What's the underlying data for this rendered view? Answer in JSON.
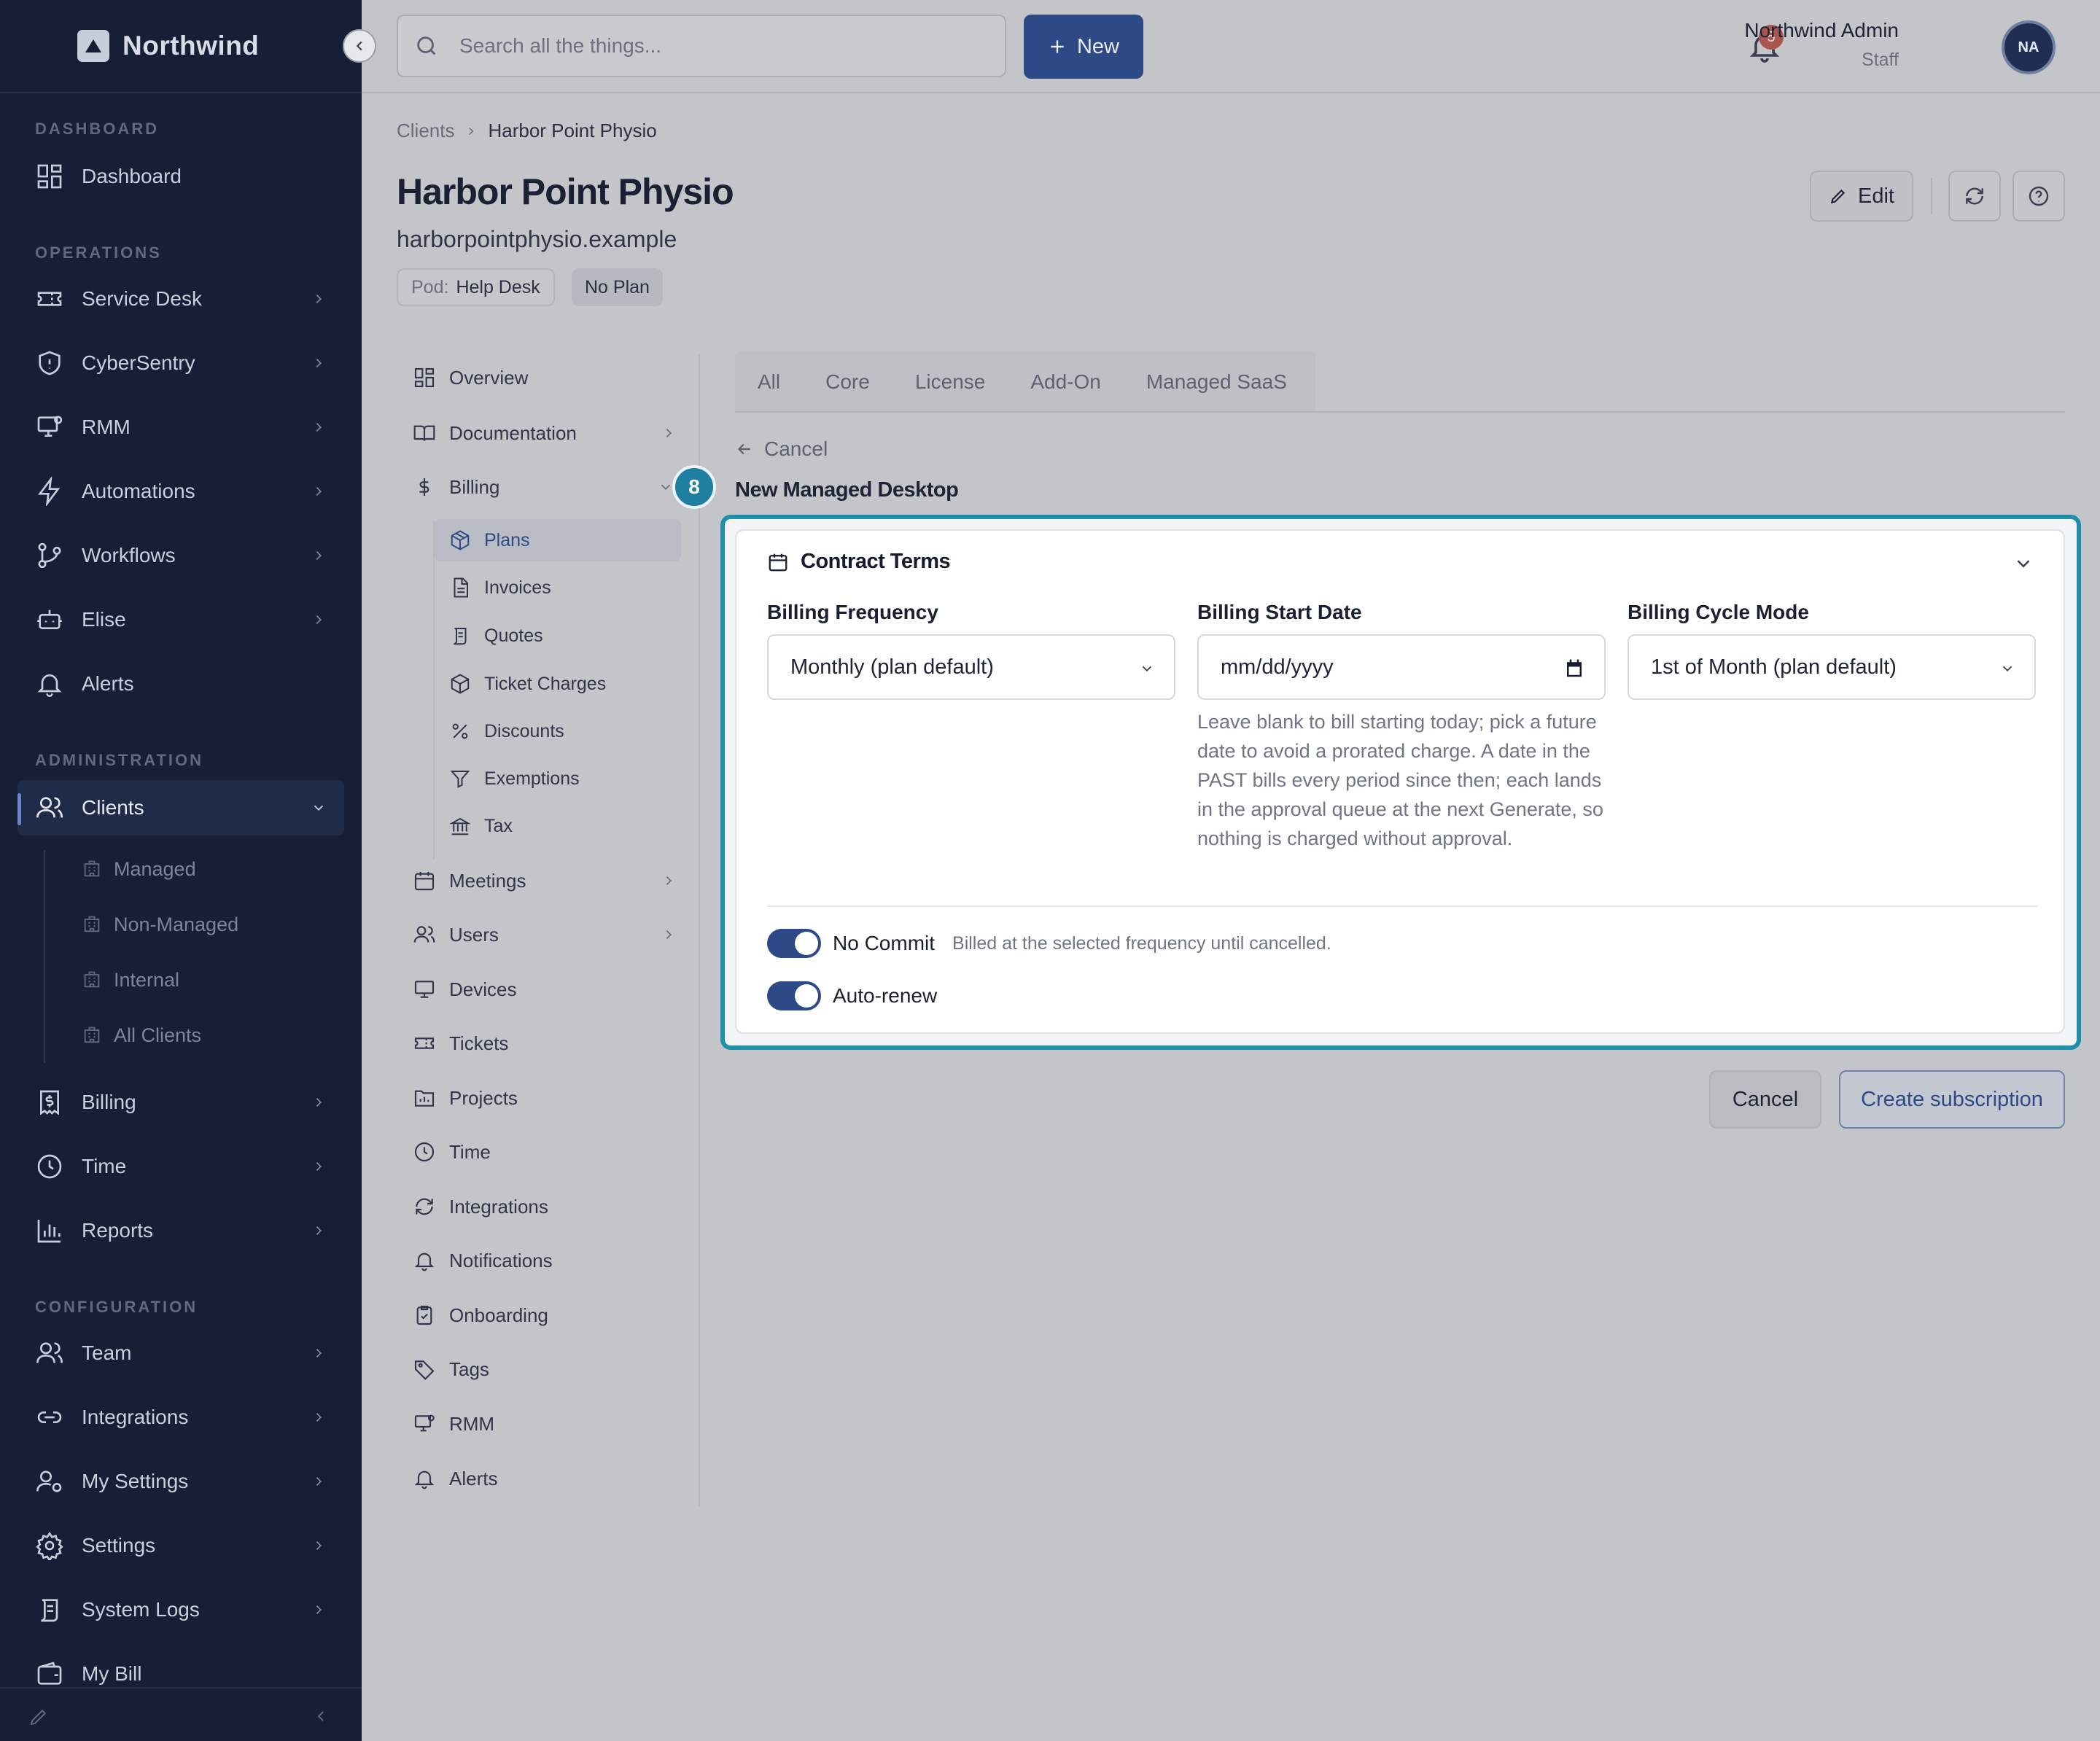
{
  "sidebar": {
    "brand": "Northwind",
    "sections": {
      "dashboard": "DASHBOARD",
      "operations": "OPERATIONS",
      "administration": "ADMINISTRATION",
      "configuration": "CONFIGURATION"
    },
    "items": {
      "dashboard": "Dashboard",
      "service_desk": "Service Desk",
      "cybersentry": "CyberSentry",
      "rmm": "RMM",
      "automations": "Automations",
      "workflows": "Workflows",
      "elise": "Elise",
      "alerts": "Alerts",
      "clients": "Clients",
      "billing": "Billing",
      "time": "Time",
      "reports": "Reports",
      "team": "Team",
      "integrations": "Integrations",
      "my_settings": "My Settings",
      "settings": "Settings",
      "system_logs": "System Logs",
      "my_bill": "My Bill"
    },
    "client_sub": {
      "managed": "Managed",
      "non_managed": "Non-Managed",
      "internal": "Internal",
      "all_clients": "All Clients"
    }
  },
  "topbar": {
    "search_placeholder": "Search all the things...",
    "new_label": "New",
    "notification_count": "5",
    "user_name": "Northwind Admin",
    "user_role": "Staff",
    "avatar_initials": "NA"
  },
  "breadcrumb": {
    "parent": "Clients",
    "current": "Harbor Point Physio"
  },
  "client": {
    "name": "Harbor Point Physio",
    "domain": "harborpointphysio.example",
    "pod_label": "Pod:",
    "pod_value": "Help Desk",
    "plan_badge": "No Plan",
    "edit_label": "Edit"
  },
  "client_nav": {
    "overview": "Overview",
    "documentation": "Documentation",
    "billing": "Billing",
    "billing_sub": {
      "plans": "Plans",
      "invoices": "Invoices",
      "quotes": "Quotes",
      "ticket_charges": "Ticket Charges",
      "discounts": "Discounts",
      "exemptions": "Exemptions",
      "tax": "Tax"
    },
    "meetings": "Meetings",
    "users": "Users",
    "devices": "Devices",
    "tickets": "Tickets",
    "projects": "Projects",
    "time": "Time",
    "integrations": "Integrations",
    "notifications": "Notifications",
    "onboarding": "Onboarding",
    "tags": "Tags",
    "rmm": "RMM",
    "alerts": "Alerts"
  },
  "tabs": [
    "All",
    "Core",
    "License",
    "Add-On",
    "Managed SaaS"
  ],
  "form": {
    "back_label": "Cancel",
    "title": "New Managed Desktop",
    "step_number": "8",
    "section_title": "Contract Terms",
    "billing_frequency_label": "Billing Frequency",
    "billing_frequency_value": "Monthly (plan default)",
    "billing_start_label": "Billing Start Date",
    "billing_start_placeholder": "mm/dd/yyyy",
    "billing_start_help": "Leave blank to bill starting today; pick a future date to avoid a prorated charge. A date in the PAST bills every period since then; each lands in the approval queue at the next Generate, so nothing is charged without approval.",
    "billing_cycle_label": "Billing Cycle Mode",
    "billing_cycle_value": "1st of Month (plan default)",
    "no_commit_label": "No Commit",
    "no_commit_desc": "Billed at the selected frequency until cancelled.",
    "auto_renew_label": "Auto-renew",
    "cancel_label": "Cancel",
    "create_label": "Create subscription"
  },
  "colors": {
    "sidebar_bg": "#161f36",
    "accent": "#2d4a86",
    "highlight": "#1f8fab",
    "badge": "#a8564e"
  }
}
